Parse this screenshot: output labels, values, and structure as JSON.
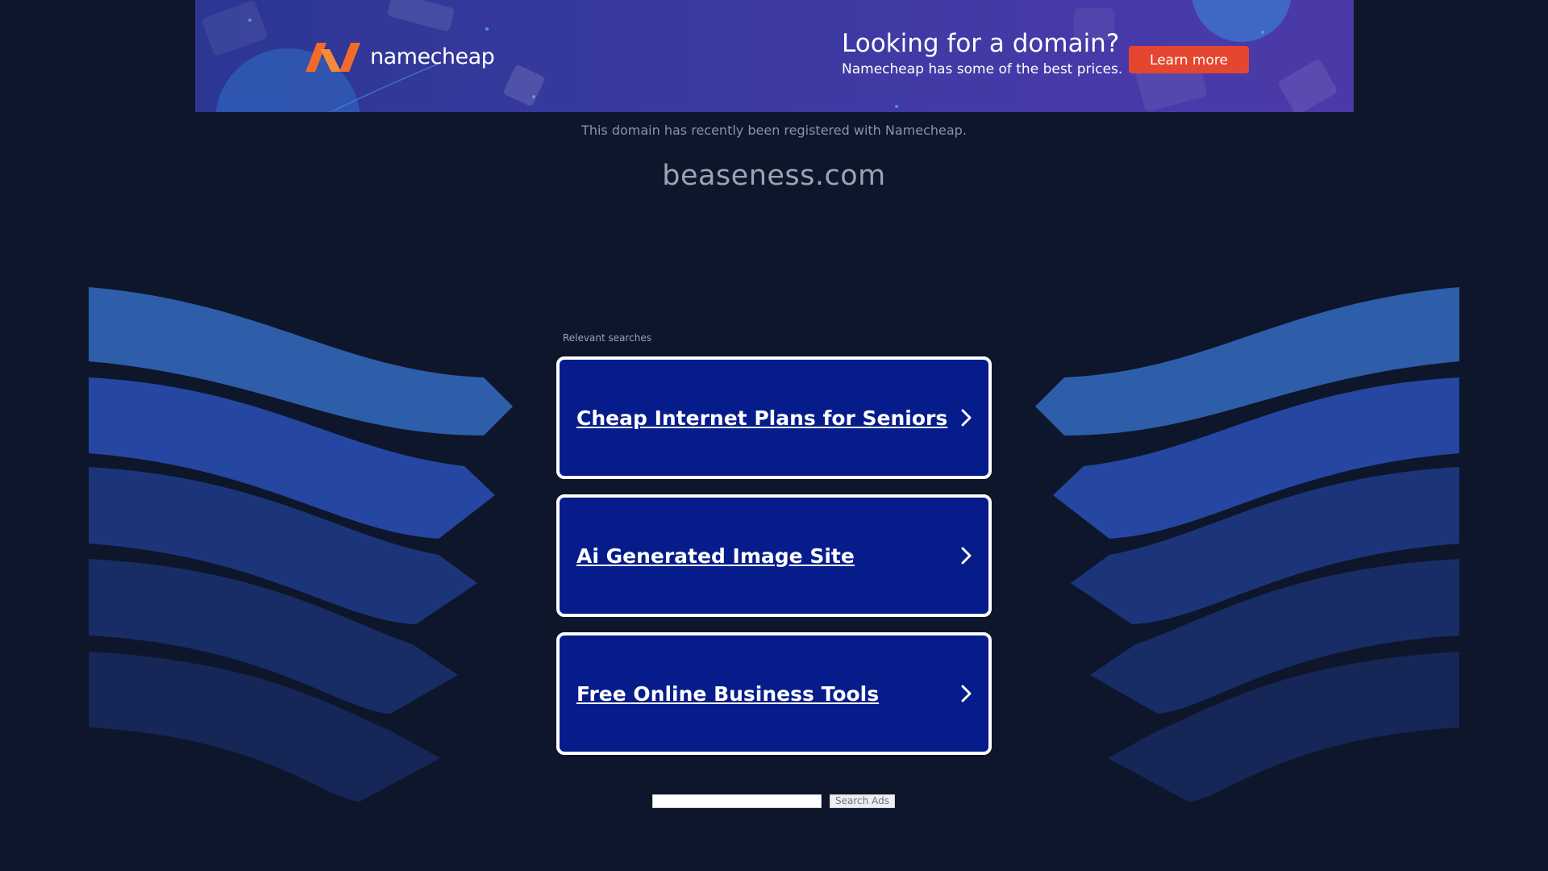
{
  "banner": {
    "logo_text": "namecheap",
    "headline": "Looking for a domain?",
    "subline": "Namecheap has some of the best prices.",
    "cta_label": "Learn more",
    "colors": {
      "logo_orange": "#f26b2a",
      "cta_red": "#e5462f"
    }
  },
  "page": {
    "registered_note": "This domain has recently been registered with Namecheap.",
    "domain": "beaseness.com"
  },
  "searches": {
    "label": "Relevant searches",
    "items": [
      {
        "label": "Cheap Internet Plans for Seniors",
        "icon": "chevron-right-icon"
      },
      {
        "label": "Ai Generated Image Site",
        "icon": "chevron-right-icon"
      },
      {
        "label": "Free Online Business Tools",
        "icon": "chevron-right-icon"
      }
    ]
  },
  "search_box": {
    "value": "",
    "button_label": "Search Ads"
  },
  "colors": {
    "background": "#0e162b",
    "card_fill": "#051c8a",
    "card_border": "#ffffff"
  }
}
